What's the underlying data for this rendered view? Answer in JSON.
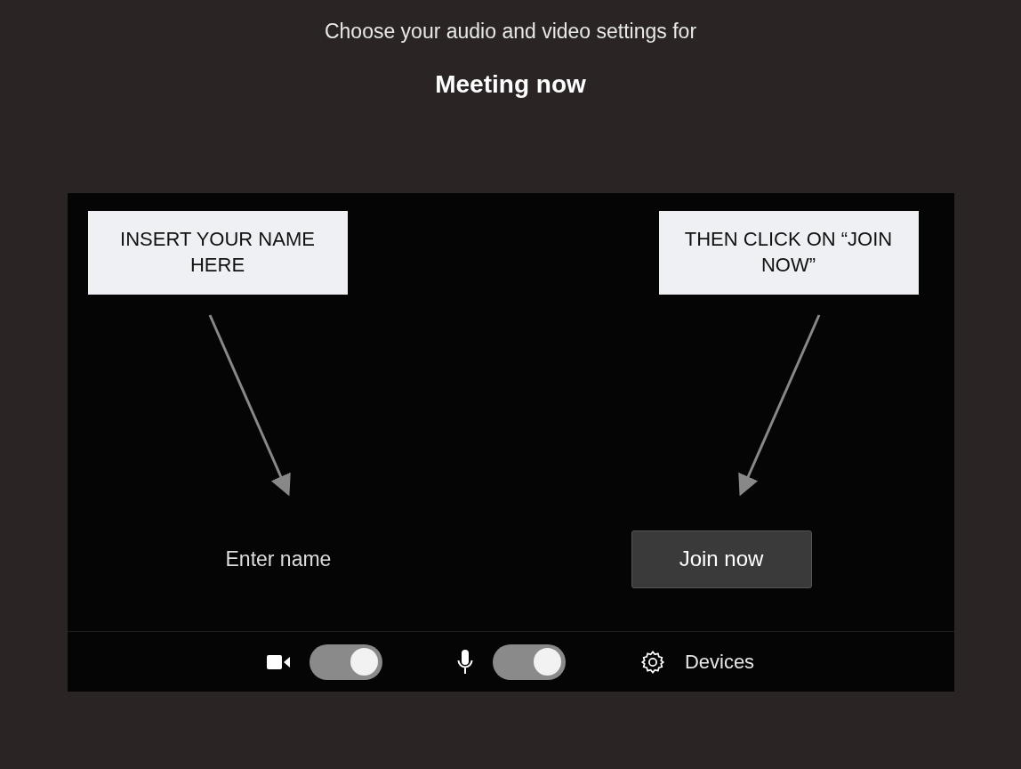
{
  "heading": "Choose your audio and video settings for",
  "meeting_title": "Meeting now",
  "annotations": [
    {
      "text": "INSERT YOUR NAME HERE"
    },
    {
      "text": "THEN CLICK ON “JOIN NOW”"
    }
  ],
  "name_field": {
    "placeholder": "Enter name"
  },
  "join_button": "Join now",
  "camera": {
    "on": true
  },
  "microphone": {
    "on": true
  },
  "devices_label": "Devices"
}
